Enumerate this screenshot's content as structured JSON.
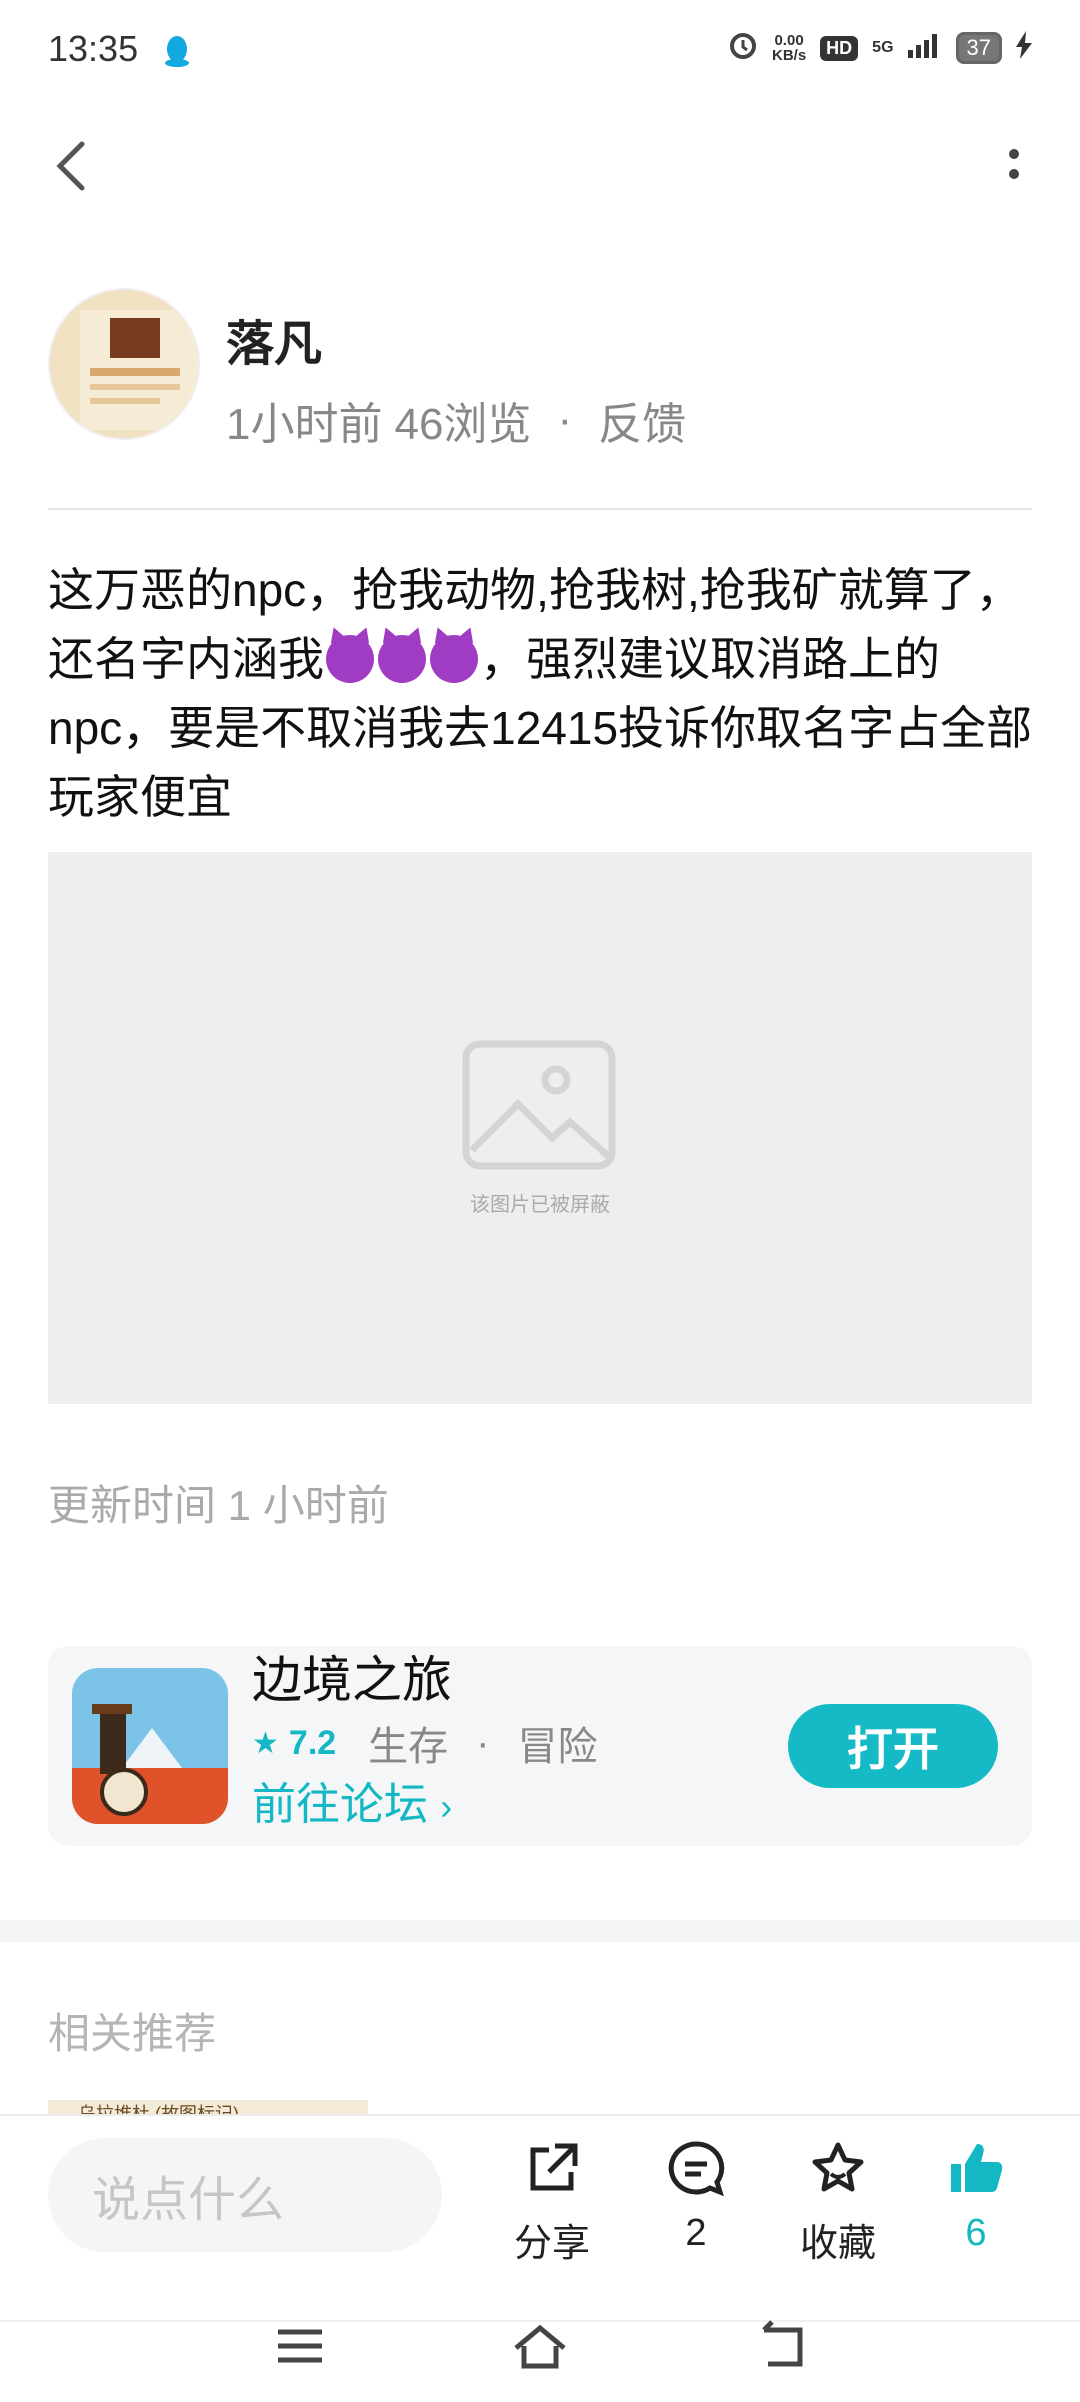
{
  "status_bar": {
    "time": "13:35",
    "net_speed": "0.00\nKB/s",
    "hd": "HD",
    "signal": "5G",
    "battery": "37"
  },
  "author": {
    "name": "落凡",
    "time_ago": "1小时前",
    "views": "46浏览",
    "separator": "·",
    "feedback": "反馈"
  },
  "post": {
    "segments": [
      "这万恶的npc，抢我动物,抢我树,抢我矿就算了，还名字内涵我",
      "，强烈建议取消路上的npc，要是不取消我去12415投诉你取名字占全部玩家便宜"
    ],
    "emoji_icon": "smiling-face-with-horns-icon",
    "blocked_image_text": "该图片已被屏蔽",
    "update_time": "更新时间 1 小时前"
  },
  "app_card": {
    "name": "边境之旅",
    "rating": "7.2",
    "genre1": "生存",
    "dot": "·",
    "genre2": "冒险",
    "forum_link": "前往论坛",
    "open_button": "打开"
  },
  "recommend": {
    "title": "相关推荐",
    "thumb_text": "乌拉堆杜 (故图标记)"
  },
  "bottom_bar": {
    "comment_placeholder": "说点什么",
    "share_label": "分享",
    "comment_count": "2",
    "favorite_label": "收藏",
    "like_count": "6"
  },
  "colors": {
    "accent": "#14b8c4",
    "text_muted": "#888888",
    "card_bg": "#f5f6f7"
  }
}
